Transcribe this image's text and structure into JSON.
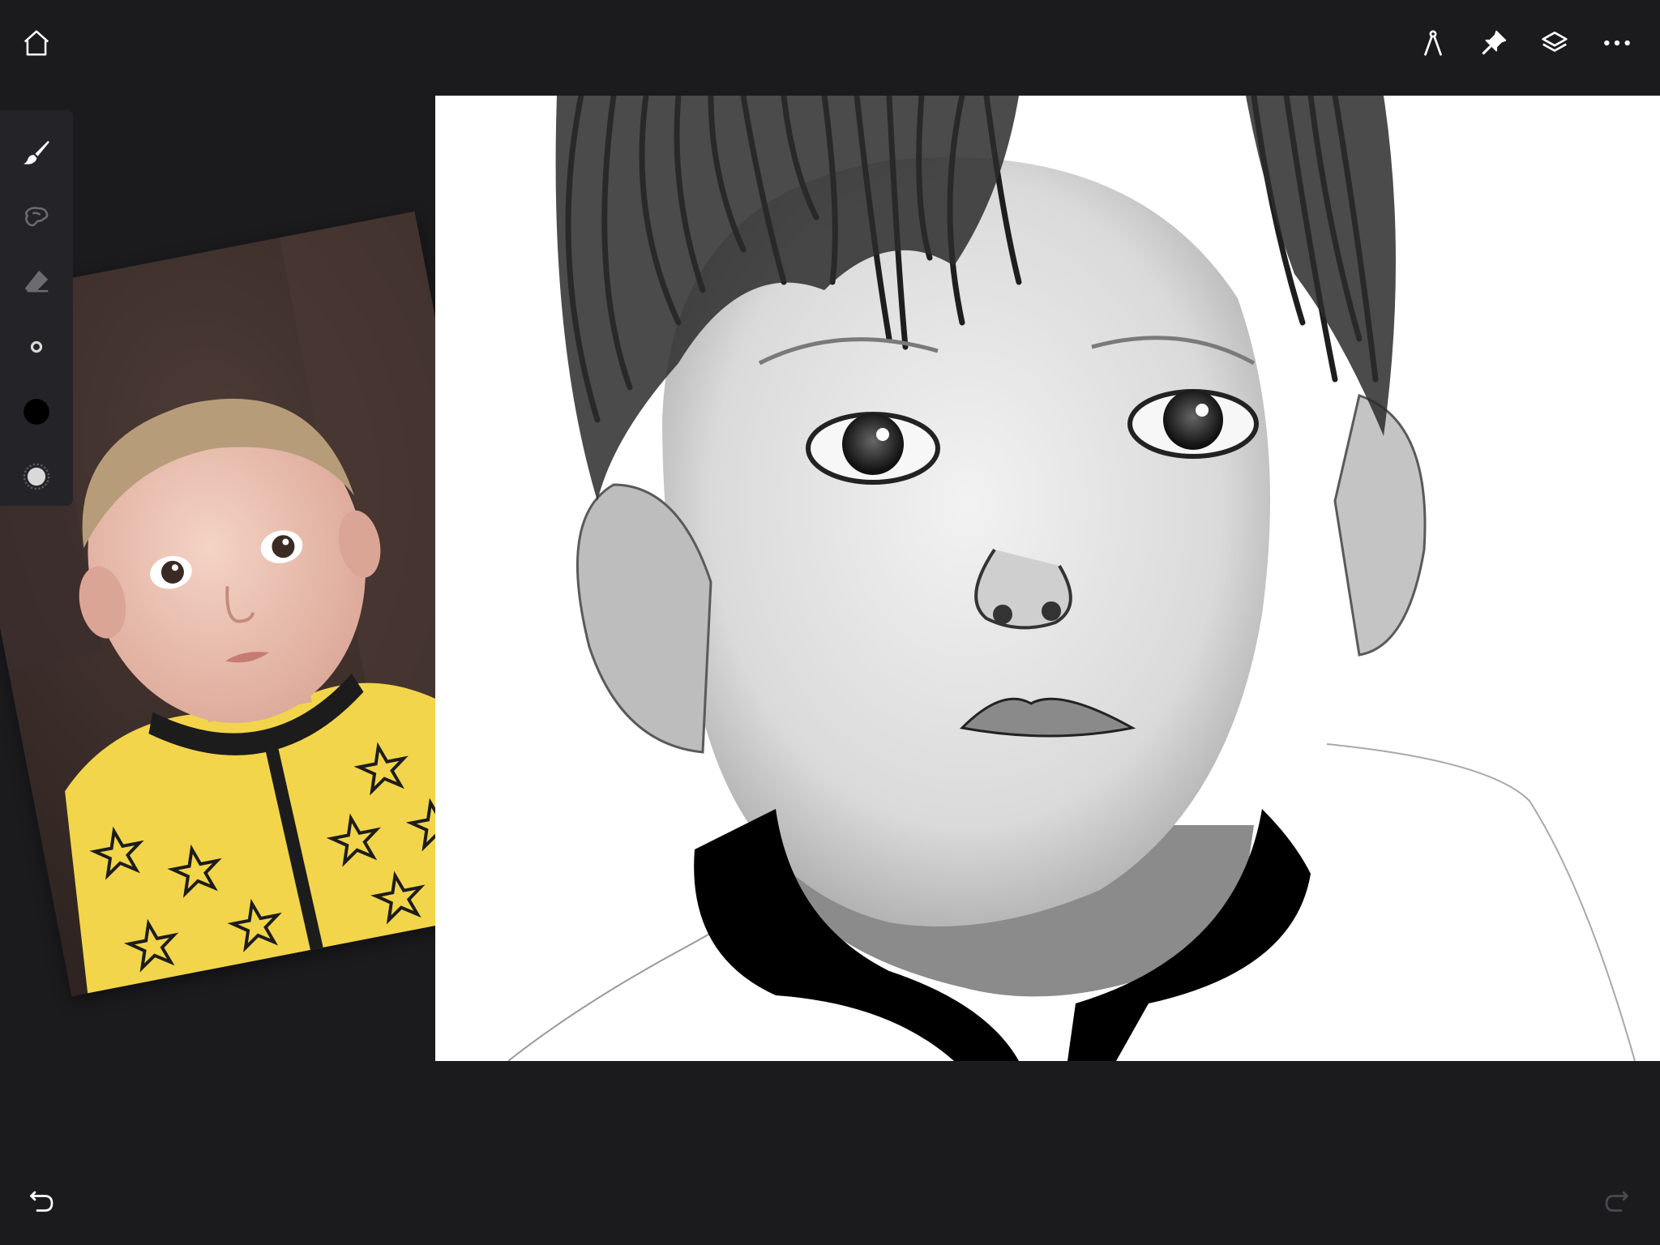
{
  "app": {
    "background_color": "#1b1b1e",
    "toolbar_color": "#242428",
    "icon_color": "#ffffff",
    "disabled_icon_color": "#4a4a4e"
  },
  "topbar": {
    "left_icons": [
      "home-icon"
    ],
    "right_icons": [
      "ruler-icon",
      "pin-icon",
      "layers-icon",
      "more-icon"
    ]
  },
  "tools": [
    {
      "icon": "brush-icon",
      "state": "selected"
    },
    {
      "icon": "smudge-icon",
      "state": "inactive"
    },
    {
      "icon": "eraser-icon",
      "state": "inactive"
    },
    {
      "icon": "brush-size-icon",
      "state": "inactive"
    },
    {
      "icon": "color-swatch-icon",
      "state": "inactive",
      "color": "#000000"
    },
    {
      "icon": "opacity-icon",
      "state": "inactive"
    }
  ],
  "history": {
    "undo": {
      "icon": "undo-icon",
      "enabled": true
    },
    "redo": {
      "icon": "redo-icon",
      "enabled": false
    }
  },
  "reference_photo": {
    "shirt_color": "#f2d54a",
    "background_color": "#3e2f2b"
  }
}
